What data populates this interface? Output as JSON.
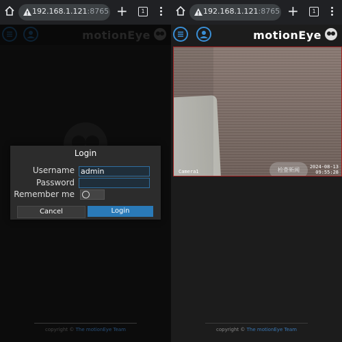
{
  "browser": {
    "host": "192.168.1.121",
    "port": ":8765",
    "tab_count": "1"
  },
  "app": {
    "title": "motionEye"
  },
  "login": {
    "title": "Login",
    "username_label": "Username",
    "username_value": "admin",
    "password_label": "Password",
    "password_value": "",
    "remember_label": "Remember me",
    "cancel_label": "Cancel",
    "login_label": "Login"
  },
  "camera": {
    "name": "Camera1",
    "date": "2024-08-13",
    "time": "09:55:28",
    "toast": "检查新闻"
  },
  "footer": {
    "copyright": "copyright © ",
    "team": "The motionEye Team"
  },
  "colors": {
    "accent": "#2a7ab8",
    "camera_border": "#a02020"
  },
  "icons": [
    "home-icon",
    "warning-icon",
    "plus-icon",
    "tabs-icon",
    "more-icon",
    "menu-icon",
    "user-icon",
    "owl-logo-icon"
  ]
}
